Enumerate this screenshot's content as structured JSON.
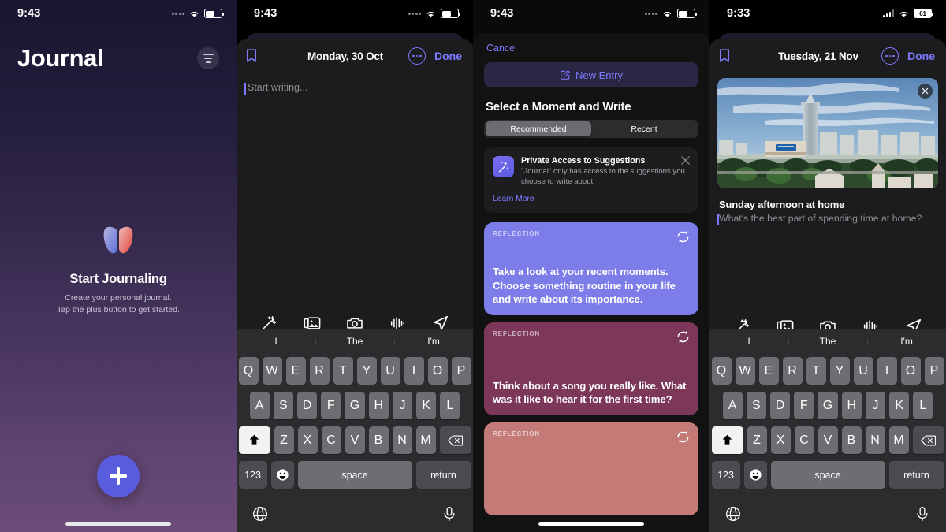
{
  "panel1": {
    "status": {
      "time": "9:43",
      "signal_icon": "signal-dots-icon",
      "wifi_icon": "wifi-icon",
      "battery_icon": "battery-icon"
    },
    "title": "Journal",
    "filter_icon": "filter-list-icon",
    "logo_icon": "journal-butterfly-logo",
    "empty_heading": "Start Journaling",
    "empty_line1": "Create your personal journal.",
    "empty_line2": "Tap the plus button to get started.",
    "fab_icon": "plus-icon",
    "colors": {
      "accent": "#5a5ce0",
      "bg_top": "#191630",
      "bg_bottom": "#6c4c78"
    }
  },
  "panel2": {
    "status": {
      "time": "9:43",
      "signal_icon": "signal-dots-icon",
      "wifi_icon": "wifi-icon",
      "battery_icon": "battery-icon"
    },
    "nav": {
      "bookmark_icon": "bookmark-icon",
      "date": "Monday, 30 Oct",
      "more_icon": "ellipsis-circle-icon",
      "done": "Done"
    },
    "editor_placeholder": "Start writing...",
    "toolbar": [
      {
        "icon": "magic-wand-icon",
        "label": "Suggestions"
      },
      {
        "icon": "photos-icon",
        "label": "Photos"
      },
      {
        "icon": "camera-icon",
        "label": "Camera"
      },
      {
        "icon": "audio-waveform-icon",
        "label": "Audio"
      },
      {
        "icon": "location-arrow-icon",
        "label": "Location"
      }
    ],
    "keyboard": {
      "predictions": [
        "I",
        "The",
        "I'm"
      ],
      "row1": [
        "Q",
        "W",
        "E",
        "R",
        "T",
        "Y",
        "U",
        "I",
        "O",
        "P"
      ],
      "row2": [
        "A",
        "S",
        "D",
        "F",
        "G",
        "H",
        "J",
        "K",
        "L"
      ],
      "row3": [
        "Z",
        "X",
        "C",
        "V",
        "B",
        "N",
        "M"
      ],
      "shift_icon": "shift-arrow-icon",
      "delete_icon": "backspace-icon",
      "numbers_key": "123",
      "emoji_icon": "emoji-smiley-icon",
      "space_key": "space",
      "return_key": "return",
      "globe_icon": "globe-icon",
      "mic_icon": "microphone-icon"
    }
  },
  "panel3": {
    "status": {
      "time": "9:43",
      "signal_icon": "signal-dots-icon",
      "wifi_icon": "wifi-icon",
      "battery_icon": "battery-icon"
    },
    "cancel": "Cancel",
    "new_entry": {
      "label": "New Entry",
      "icon": "compose-square-pencil-icon"
    },
    "section_heading": "Select a Moment and Write",
    "segments": [
      {
        "label": "Recommended",
        "selected": true
      },
      {
        "label": "Recent",
        "selected": false
      }
    ],
    "privacy": {
      "icon": "magic-wand-app-icon",
      "title": "Private Access to Suggestions",
      "body": "\"Journal\" only has access to the suggestions you choose to write about.",
      "link": "Learn More",
      "close_icon": "close-x-icon"
    },
    "cards": [
      {
        "tag": "REFLECTION",
        "text": "Take a look at your recent moments. Choose something routine in your life and write about its importance.",
        "color": "#7c7de8",
        "refresh_icon": "refresh-arrows-icon"
      },
      {
        "tag": "REFLECTION",
        "text": "Think about a song you really like. What was it like to hear it for the first time?",
        "color": "#7d3759",
        "refresh_icon": "refresh-arrows-icon"
      },
      {
        "tag": "REFLECTION",
        "text": "",
        "color": "#c47a77",
        "refresh_icon": "refresh-arrows-icon"
      }
    ]
  },
  "panel4": {
    "status": {
      "time": "9:33",
      "signal_icon": "signal-bars-icon",
      "wifi_icon": "wifi-icon",
      "battery_percent": "61"
    },
    "nav": {
      "bookmark_icon": "bookmark-icon",
      "date": "Tuesday, 21 Nov",
      "more_icon": "ellipsis-circle-icon",
      "done": "Done"
    },
    "attachment": {
      "photo_alt": "city-skyline-photo",
      "close_icon": "close-x-icon",
      "title": "Sunday afternoon at home",
      "prompt": "What's the best part of spending time at home?"
    },
    "toolbar": [
      {
        "icon": "magic-wand-icon",
        "label": "Suggestions"
      },
      {
        "icon": "photos-icon",
        "label": "Photos"
      },
      {
        "icon": "camera-icon",
        "label": "Camera"
      },
      {
        "icon": "audio-waveform-icon",
        "label": "Audio"
      },
      {
        "icon": "location-arrow-icon",
        "label": "Location"
      }
    ],
    "keyboard": {
      "predictions": [
        "I",
        "The",
        "I'm"
      ],
      "row1": [
        "Q",
        "W",
        "E",
        "R",
        "T",
        "Y",
        "U",
        "I",
        "O",
        "P"
      ],
      "row2": [
        "A",
        "S",
        "D",
        "F",
        "G",
        "H",
        "J",
        "K",
        "L"
      ],
      "row3": [
        "Z",
        "X",
        "C",
        "V",
        "B",
        "N",
        "M"
      ],
      "shift_icon": "shift-arrow-icon",
      "delete_icon": "backspace-icon",
      "numbers_key": "123",
      "emoji_icon": "emoji-smiley-icon",
      "space_key": "space",
      "return_key": "return",
      "globe_icon": "globe-icon",
      "mic_icon": "microphone-icon"
    }
  }
}
